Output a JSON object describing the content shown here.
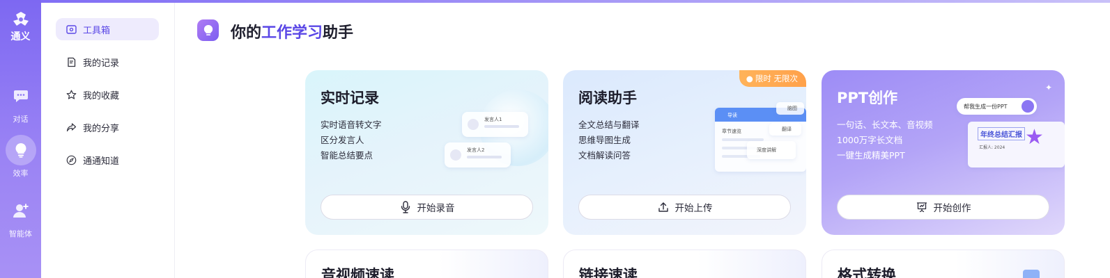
{
  "rail": {
    "logo_label": "通义",
    "items": [
      {
        "label": "对话",
        "icon": "chat-icon"
      },
      {
        "label": "效率",
        "icon": "lightbulb-icon"
      },
      {
        "label": "智能体",
        "icon": "agent-icon"
      }
    ]
  },
  "sidebar": {
    "items": [
      {
        "label": "工具箱",
        "icon": "toolbox-icon"
      },
      {
        "label": "我的记录",
        "icon": "record-icon"
      },
      {
        "label": "我的收藏",
        "icon": "star-icon"
      },
      {
        "label": "我的分享",
        "icon": "share-icon"
      },
      {
        "label": "通通知道",
        "icon": "compass-icon"
      }
    ]
  },
  "header": {
    "title_prefix": "你的",
    "title_highlight": "工作学习",
    "title_suffix": "助手"
  },
  "cards": [
    {
      "title": "实时记录",
      "lines": [
        "实时语音转文字",
        "区分发言人",
        "智能总结要点"
      ],
      "button": "开始录音",
      "button_icon": "microphone-icon",
      "ill_speaker1": "发言人1",
      "ill_speaker2": "发言人2"
    },
    {
      "title": "阅读助手",
      "lines": [
        "全文总结与翻译",
        "思维导图生成",
        "文档解读问答"
      ],
      "button": "开始上传",
      "button_icon": "upload-icon",
      "badge": "限时 无限次",
      "ill_tab": "导读",
      "ill_row": "章节速览",
      "ill_chip1": "脑图",
      "ill_chip2": "翻译",
      "ill_chip3": "深度讲解"
    },
    {
      "title": "PPT创作",
      "lines": [
        "一句话、长文本、音视频",
        "1000万字长文档",
        "一键生成精美PPT"
      ],
      "button": "开始创作",
      "button_icon": "presentation-icon",
      "ill_prompt": "帮我生成一份PPT",
      "ill_slide_title": "年终总结汇报",
      "ill_slide_sub": "汇报人: 2024"
    }
  ],
  "bottom_cards": [
    {
      "title": "音视频速读"
    },
    {
      "title": "链接速读"
    },
    {
      "title": "格式转换"
    }
  ]
}
